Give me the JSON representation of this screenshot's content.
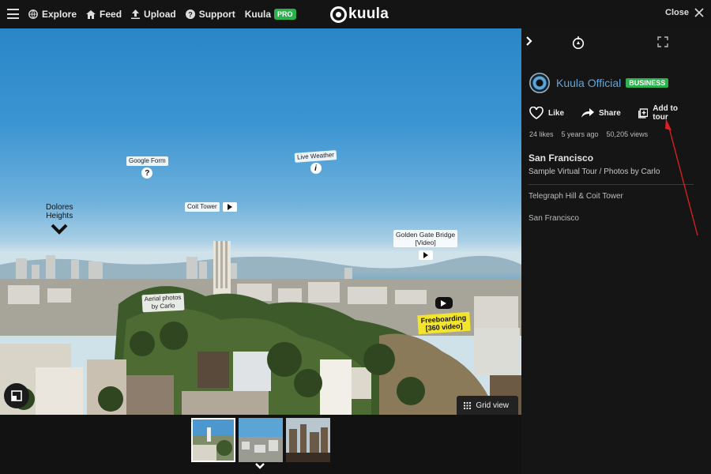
{
  "nav": {
    "explore": "Explore",
    "feed": "Feed",
    "upload": "Upload",
    "support": "Support",
    "kuula": "Kuula",
    "pro": "PRO"
  },
  "logo": "kuula",
  "close": "Close",
  "hotspots": {
    "google_form": "Google Form",
    "google_form_icon": "?",
    "live_weather": "Live Weather",
    "live_weather_icon": "i",
    "coit_tower": "Coit Tower",
    "dolores_line1": "Dolores",
    "dolores_line2": "Heights",
    "golden_gate_line1": "Golden Gate Bridge",
    "golden_gate_line2": "[Video]",
    "aerial_line1": "Aerial photos",
    "aerial_line2": "by Carlo",
    "freeboarding_line1": "Freeboarding",
    "freeboarding_line2": "[360 video]"
  },
  "grid_view": "Grid view",
  "sidebar": {
    "author": "Kuula Official",
    "badge": "BUSINESS",
    "like": "Like",
    "share": "Share",
    "add_to_tour": "Add to tour",
    "likes": "24 likes",
    "age": "5 years ago",
    "views": "50,205 views",
    "title": "San Francisco",
    "subtitle": "Sample Virtual Tour / Photos by Carlo",
    "tour_items": [
      "Telegraph Hill & Coit Tower",
      "San Francisco"
    ]
  },
  "colors": {
    "accent_green": "#2bb24c",
    "link_blue": "#5fa6dc",
    "annotation_red": "#e02020",
    "tag_yellow": "#f3e52b"
  }
}
